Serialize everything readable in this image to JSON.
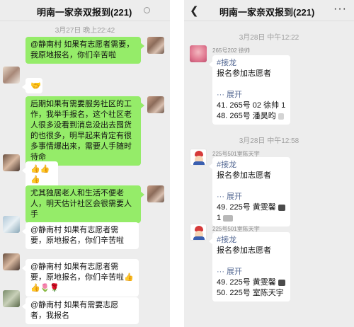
{
  "left_panel": {
    "title": "明南一家亲双报到(221)",
    "timestamp": "3月27日 晚上22:42",
    "messages": [
      {
        "side": "right",
        "text": "@静南村  如果有志愿者需要，我原地报名，你们辛苦啦"
      },
      {
        "side": "left",
        "text": "🤝"
      },
      {
        "side": "right",
        "text": "后期如果有需要服务社区的工作，我举手报名，这个社区老人很多没看到消息没出去囤货的也很多，明早起来肯定有很多事情爆出来，需要人手随时待命"
      },
      {
        "side": "left",
        "text": "👍👍👍"
      },
      {
        "side": "right",
        "text": "尤其独居老人和生活不便老人，明天估计社区会很需要人手"
      },
      {
        "side": "left",
        "text": "@静南村  如果有志愿者需要，原地报名，你们辛苦啦"
      },
      {
        "side": "left",
        "text": "@静南村  如果有志愿者需要，原地报名，你们辛苦啦👍👍🌷🌹"
      },
      {
        "side": "left",
        "text": "@静南村  如果有需要志愿者，我报名"
      }
    ]
  },
  "right_panel": {
    "title": "明南一家亲双报到(221)",
    "back_icon": "chevron-left-icon",
    "more_icon": "more-dots-icon",
    "timestamp_1": "3月28日 中午12:22",
    "timestamp_2": "3月28日 中午12:58",
    "messages": [
      {
        "sender": "265号202 徐帅",
        "tag": "#接龙",
        "line1": "报名参加志愿者",
        "expand": "展开",
        "entries": [
          "41. 265号 02 徐帅 1",
          "48. 265号 潘昊昀"
        ]
      },
      {
        "sender": "225号501室陈天宇",
        "tag": "#接龙",
        "line1": "报名参加志愿者",
        "expand": "展开",
        "entries": [
          "49. 225号 黄雯馨",
          "1"
        ]
      },
      {
        "sender": "225号501室陈天宇",
        "tag": "#接龙",
        "line1": "报名参加志愿者",
        "expand": "展开",
        "entries": [
          "49. 225号 黄雯馨",
          "50. 225号 室陈天宇"
        ]
      }
    ]
  }
}
